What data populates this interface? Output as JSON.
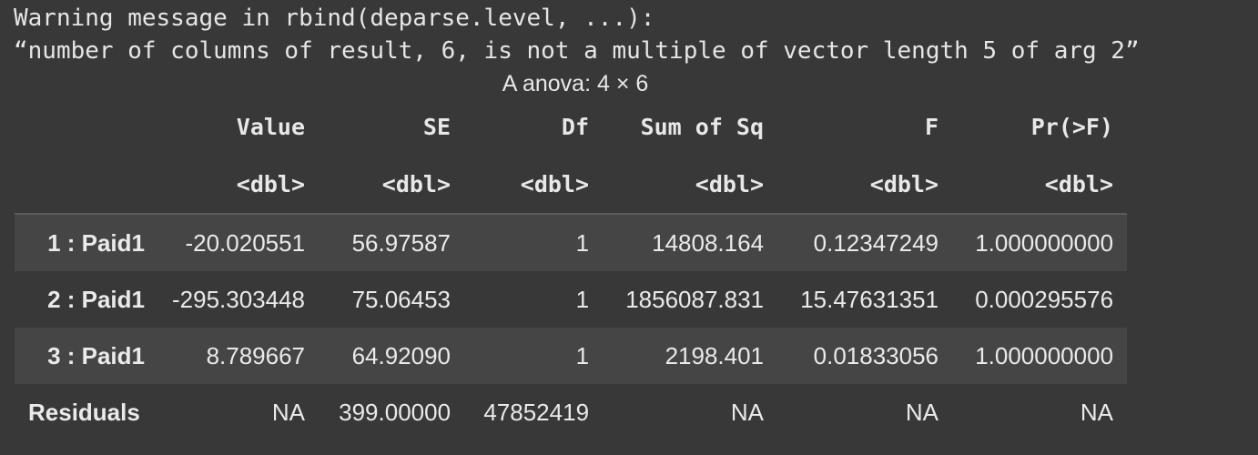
{
  "warning": {
    "line1": "Warning message in rbind(deparse.level, ...):",
    "line2": "“number of columns of result, 6, is not a multiple of vector length 5 of arg 2”"
  },
  "table": {
    "caption": "A anova: 4 × 6",
    "columns": [
      "Value",
      "SE",
      "Df",
      "Sum of Sq",
      "F",
      "Pr(>F)"
    ],
    "types": [
      "<dbl>",
      "<dbl>",
      "<dbl>",
      "<dbl>",
      "<dbl>",
      "<dbl>"
    ],
    "rows": [
      {
        "name": "1 : Paid1",
        "cells": [
          "-20.020551",
          "56.97587",
          "1",
          "14808.164",
          "0.12347249",
          "1.000000000"
        ]
      },
      {
        "name": "2 : Paid1",
        "cells": [
          "-295.303448",
          "75.06453",
          "1",
          "1856087.831",
          "15.47631351",
          "0.000295576"
        ]
      },
      {
        "name": "3 : Paid1",
        "cells": [
          "8.789667",
          "64.92090",
          "1",
          "2198.401",
          "0.01833056",
          "1.000000000"
        ]
      },
      {
        "name": "Residuals",
        "cells": [
          "NA",
          "399.00000",
          "47852419",
          "NA",
          "NA",
          "NA"
        ]
      }
    ]
  },
  "colors": {
    "background": "#383838",
    "stripe": "#454545",
    "text": "#e8e8e8"
  }
}
